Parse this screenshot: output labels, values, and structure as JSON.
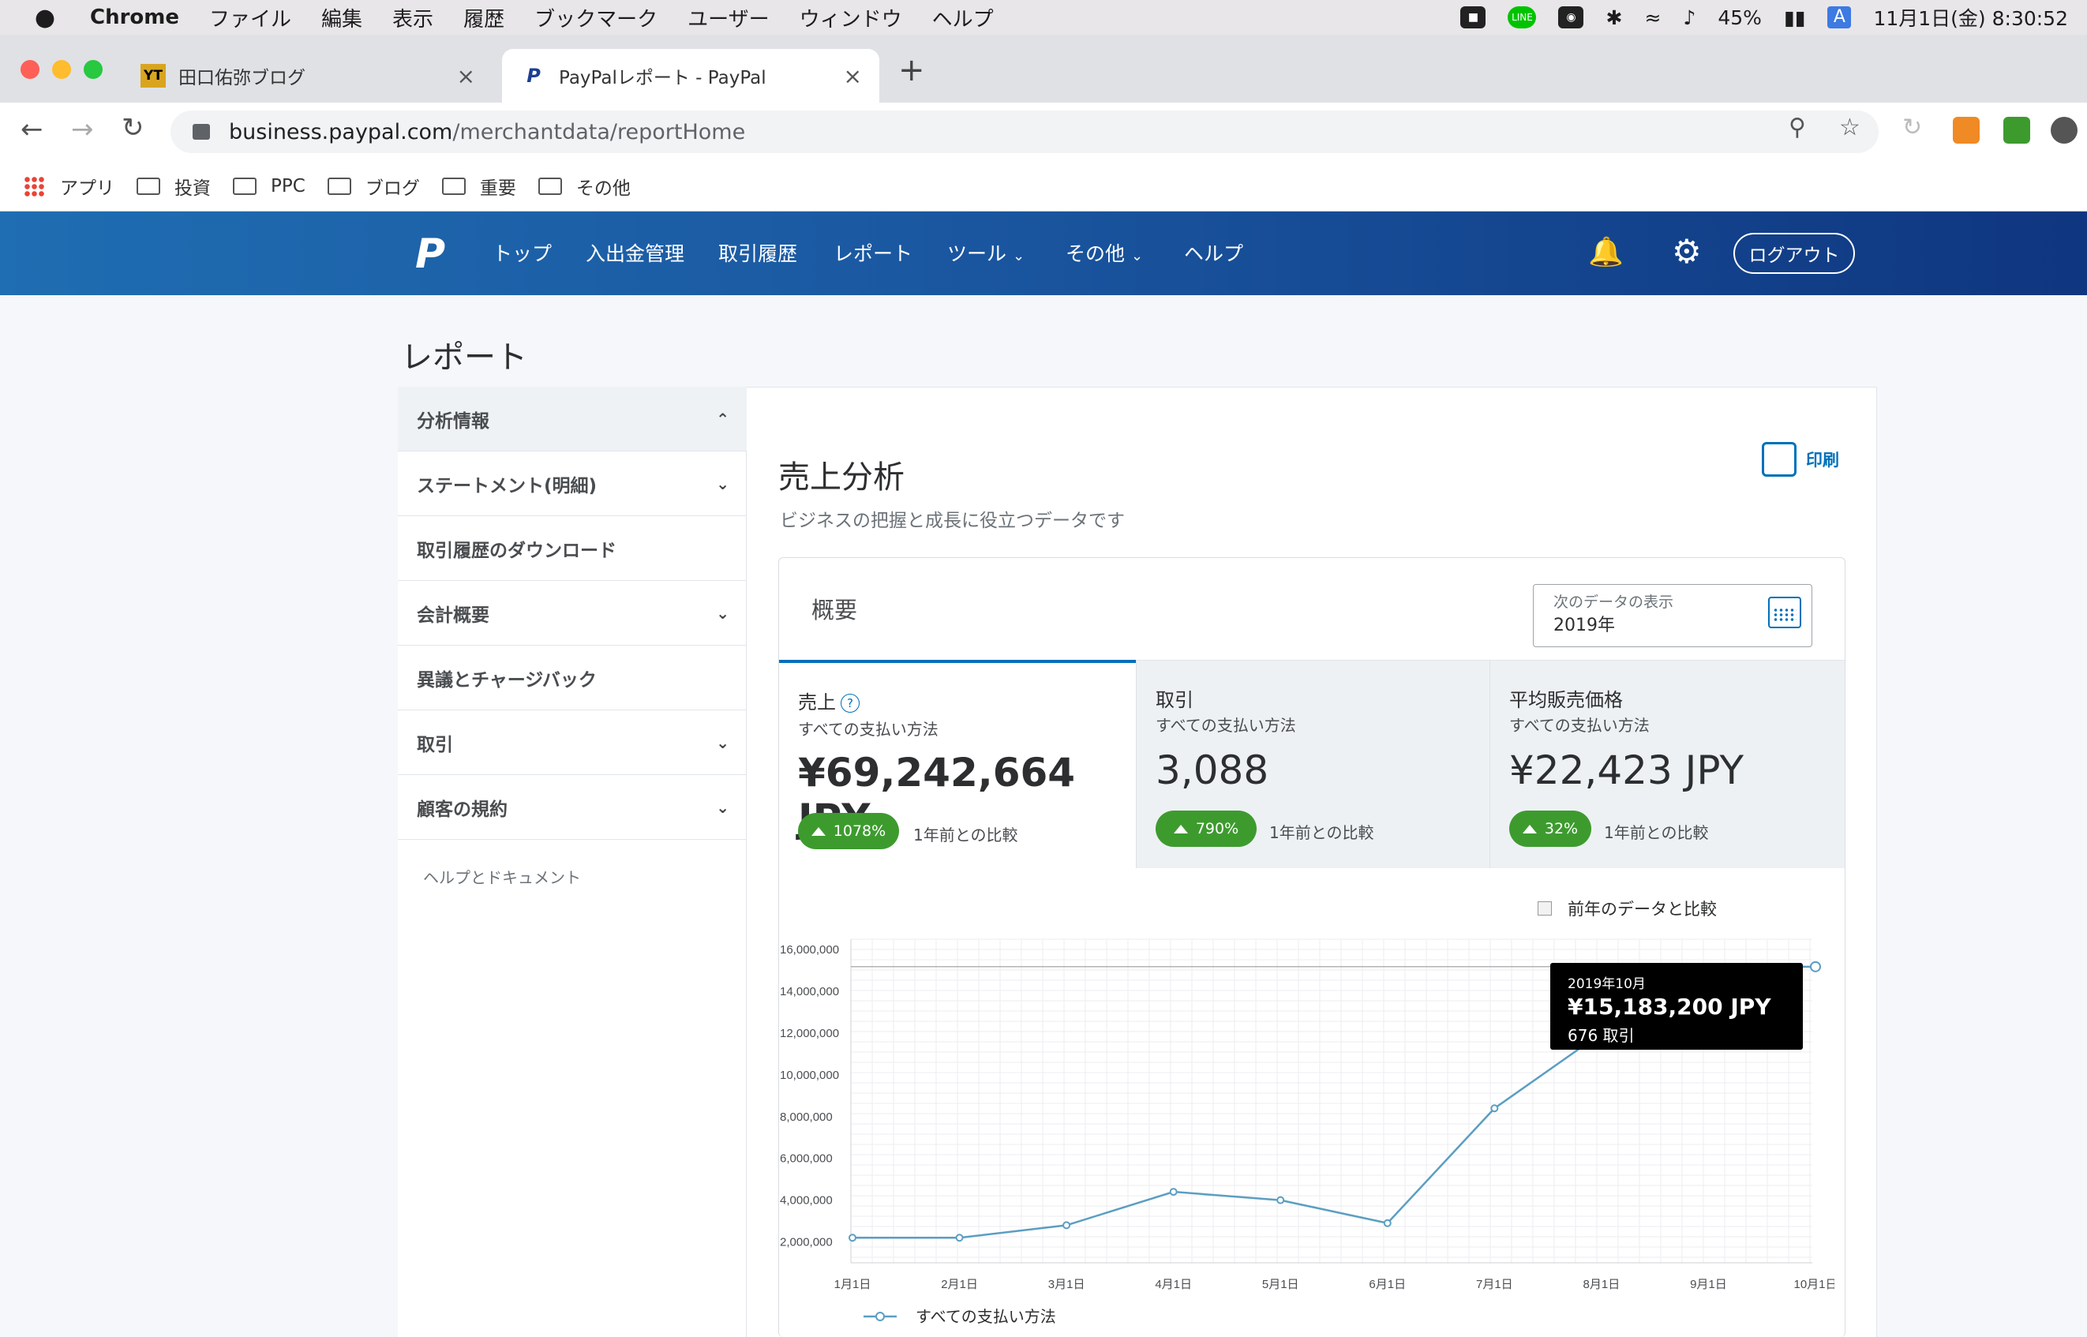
{
  "menubar": {
    "app": "Chrome",
    "items": [
      "ファイル",
      "編集",
      "表示",
      "履歴",
      "ブックマーク",
      "ユーザー",
      "ウィンドウ",
      "ヘルプ"
    ],
    "battery": "45%",
    "datetime": "11月1日(金)  8:30:52",
    "input_mode": "A"
  },
  "tabs": [
    {
      "title": "田口佑弥ブログ",
      "favicon": "YT"
    },
    {
      "title": "PayPalレポート - PayPal",
      "favicon": "P"
    }
  ],
  "address": {
    "host": "business.paypal.com",
    "path": "/merchantdata/reportHome"
  },
  "bookmarks": [
    "アプリ",
    "投資",
    "PPC",
    "ブログ",
    "重要",
    "その他"
  ],
  "pp_nav": {
    "items": [
      "トップ",
      "入出金管理",
      "取引履歴",
      "レポート",
      "ツール",
      "その他",
      "ヘルプ"
    ],
    "logout": "ログアウト"
  },
  "page": {
    "title": "レポート"
  },
  "sidebar": {
    "items": [
      {
        "label": "分析情報",
        "chevron": "up"
      },
      {
        "label": "ステートメント(明細)",
        "chevron": "down"
      },
      {
        "label": "取引履歴のダウンロード",
        "chevron": ""
      },
      {
        "label": "会計概要",
        "chevron": "down"
      },
      {
        "label": "異議とチャージバック",
        "chevron": ""
      },
      {
        "label": "取引",
        "chevron": "down"
      },
      {
        "label": "顧客の規約",
        "chevron": "down"
      }
    ],
    "help": "ヘルプとドキュメント"
  },
  "main": {
    "title": "売上分析",
    "subtitle": "ビジネスの把握と成長に役立つデータです",
    "print": "印刷"
  },
  "summary": {
    "title": "概要",
    "date_label": "次のデータの表示",
    "date_value": "2019年",
    "metrics": [
      {
        "label": "売上",
        "sub": "すべての支払い方法",
        "value": "¥69,242,664 JPY",
        "change": "1078%",
        "compare": "1年前との比較"
      },
      {
        "label": "取引",
        "sub": "すべての支払い方法",
        "value": "3,088",
        "change": "790%",
        "compare": "1年前との比較"
      },
      {
        "label": "平均販売価格",
        "sub": "すべての支払い方法",
        "value": "¥22,423 JPY",
        "change": "32%",
        "compare": "1年前との比較"
      }
    ],
    "compare_checkbox": "前年のデータと比較"
  },
  "tooltip": {
    "month": "2019年10月",
    "amount": "¥15,183,200 JPY",
    "count": "676 取引"
  },
  "colors": {
    "brand": "#0070ba",
    "accent_green": "#3d9b2e",
    "line": "#5b9ec2"
  },
  "chart_data": {
    "type": "line",
    "categories": [
      "1月1日",
      "2月1日",
      "3月1日",
      "4月1日",
      "5月1日",
      "6月1日",
      "7月1日",
      "8月1日",
      "9月1日",
      "10月1日"
    ],
    "series": [
      {
        "name": "すべての支払い方法",
        "values": [
          2200000,
          2200000,
          2800000,
          4400000,
          4000000,
          2900000,
          8400000,
          12000000,
          15183200,
          15183200
        ]
      }
    ],
    "ylim": [
      1000000,
      16500000
    ],
    "yticks": [
      2000000,
      4000000,
      6000000,
      8000000,
      10000000,
      12000000,
      14000000,
      16000000
    ],
    "ytick_labels": [
      "2,000,000",
      "4,000,000",
      "6,000,000",
      "8,000,000",
      "10,000,000",
      "12,000,000",
      "14,000,000",
      "16,000,000"
    ],
    "grid": true,
    "legend_position": "bottom-left",
    "highlight_value": 15183200
  }
}
